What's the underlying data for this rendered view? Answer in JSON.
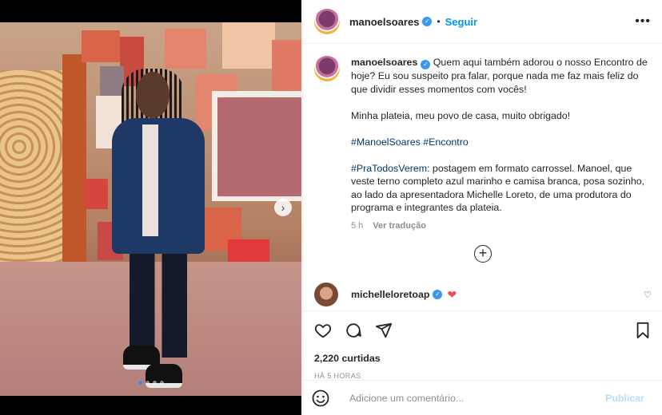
{
  "post": {
    "username": "manoelsoares",
    "follow_label": "Seguir",
    "separator": "•",
    "more_label": "•••"
  },
  "caption": {
    "username": "manoelsoares",
    "line1": "Quem aqui também adorou o nosso Encontro de hoje? Eu sou suspeito pra falar, porque nada me faz mais feliz do que dividir esses momentos com vocês!",
    "line2": "Minha plateia, meu povo de casa, muito obrigado!",
    "hashtags": "#ManoelSoares #Encontro",
    "accessibility_tag": "#PraTodosVerem",
    "accessibility_text": ": postagem em formato carrossel. Manoel, que veste terno completo azul marinho e camisa branca, posa sozinho, ao lado da apresentadora Michelle Loreto, de uma produtora do programa e integrantes da plateia.",
    "age": "5 h",
    "translate_label": "Ver tradução"
  },
  "load_more_label": "+",
  "reply": {
    "username": "michelleloretoap",
    "heart": "❤"
  },
  "stats": {
    "likes": "2,220 curtidas",
    "time": "HÁ 5 HORAS"
  },
  "comment_box": {
    "placeholder": "Adicione um comentário...",
    "publish_label": "Publicar"
  },
  "carousel": {
    "next_label": "›",
    "current_index": 1,
    "total": 4
  },
  "colors": {
    "accent": "#0095f6",
    "verified": "#3897f0",
    "like_red": "#ed4956",
    "publish_disabled": "#b2dffc"
  }
}
